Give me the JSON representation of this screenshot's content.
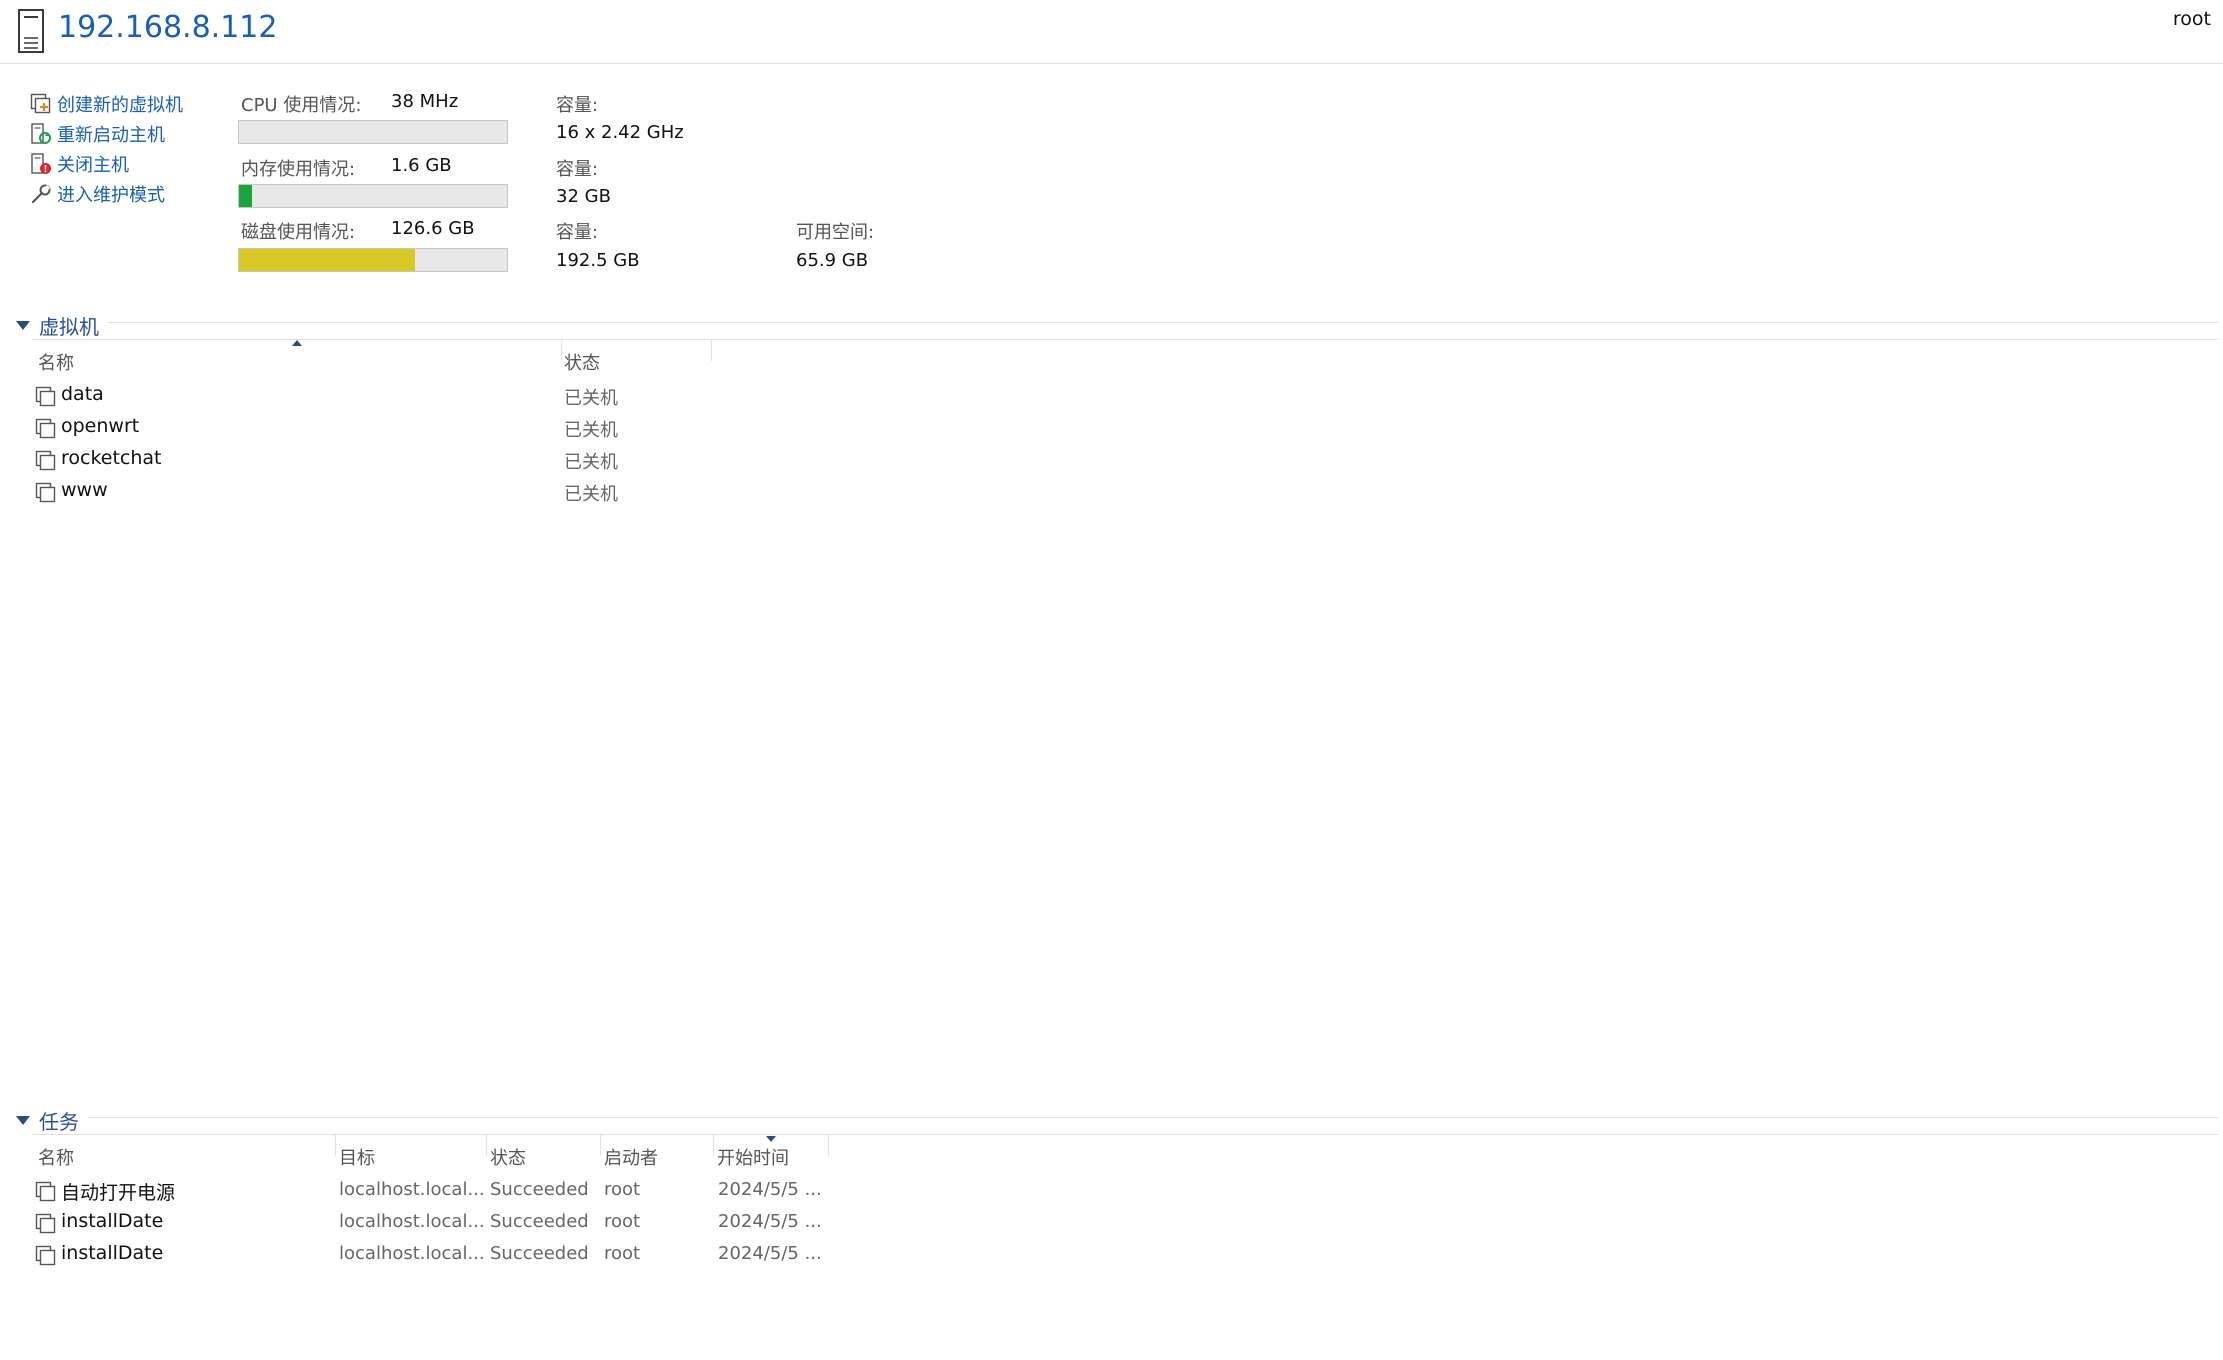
{
  "header": {
    "title": "192.168.8.112",
    "user": "root"
  },
  "actions": [
    {
      "label": "创建新的虚拟机",
      "icon": "create-vm-icon"
    },
    {
      "label": "重新启动主机",
      "icon": "reboot-host-icon"
    },
    {
      "label": "关闭主机",
      "icon": "shutdown-host-icon"
    },
    {
      "label": "进入维护模式",
      "icon": "wrench-icon"
    }
  ],
  "resources": {
    "cpu": {
      "label": "CPU 使用情况:",
      "used": "38 MHz",
      "capacity_label": "容量:",
      "capacity": "16 x 2.42 GHz",
      "usage_fraction": 0.0,
      "bar_color": "#e8e8e8"
    },
    "memory": {
      "label": "内存使用情况:",
      "used": "1.6 GB",
      "capacity_label": "容量:",
      "capacity": "32 GB",
      "usage_fraction": 0.05,
      "bar_color": "#1aa63a"
    },
    "disk": {
      "label": "磁盘使用情况:",
      "used": "126.6 GB",
      "capacity_label": "容量:",
      "capacity": "192.5 GB",
      "free_label": "可用空间:",
      "free": "65.9 GB",
      "usage_fraction": 0.658,
      "bar_color": "#d8c927"
    }
  },
  "vm_section": {
    "title": "虚拟机",
    "columns": {
      "name": "名称",
      "state": "状态"
    },
    "sort": {
      "column": "name",
      "direction": "asc"
    },
    "rows": [
      {
        "name": "data",
        "state": "已关机"
      },
      {
        "name": "openwrt",
        "state": "已关机"
      },
      {
        "name": "rocketchat",
        "state": "已关机"
      },
      {
        "name": "www",
        "state": "已关机"
      }
    ]
  },
  "tasks_section": {
    "title": "任务",
    "columns": {
      "name": "名称",
      "target": "目标",
      "status": "状态",
      "initiator": "启动者",
      "start_time": "开始时间"
    },
    "sort": {
      "column": "start_time",
      "direction": "desc"
    },
    "rows": [
      {
        "name": "自动打开电源",
        "target": "localhost.local...",
        "status": "Succeeded",
        "initiator": "root",
        "start_time": "2024/5/5 ..."
      },
      {
        "name": "installDate",
        "target": "localhost.local...",
        "status": "Succeeded",
        "initiator": "root",
        "start_time": "2024/5/5 ..."
      },
      {
        "name": "installDate",
        "target": "localhost.local...",
        "status": "Succeeded",
        "initiator": "root",
        "start_time": "2024/5/5 ..."
      }
    ]
  },
  "colors": {
    "link": "#1a5fb4",
    "section_title": "#2c4d9a",
    "memory_bar": "#1aa63a",
    "disk_bar": "#d8c927"
  }
}
